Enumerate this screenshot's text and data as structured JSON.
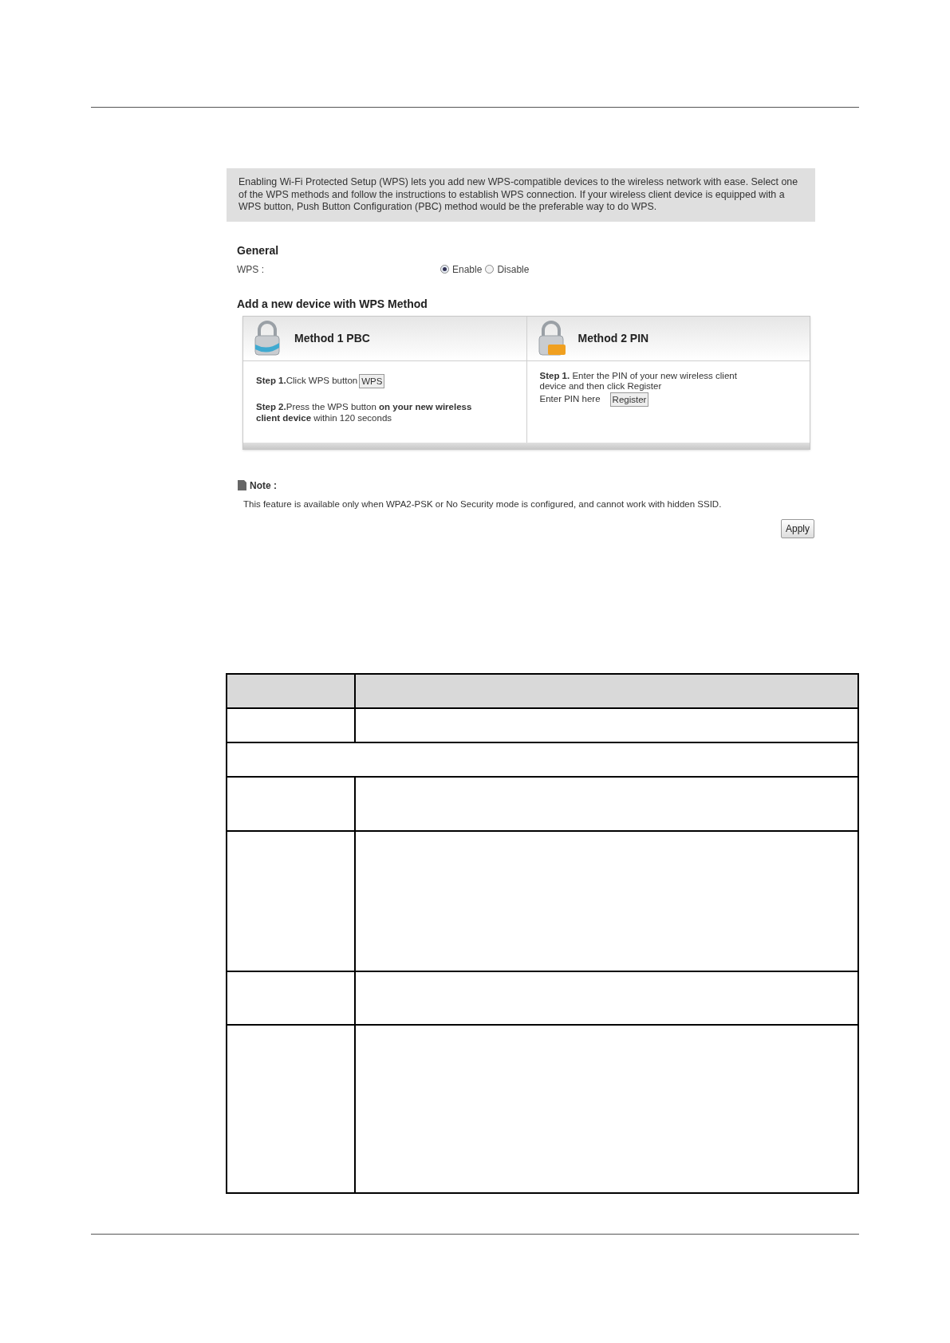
{
  "intro": "Enabling Wi-Fi Protected Setup (WPS) lets you add new WPS-compatible devices to the wireless network with ease. Select one of the WPS methods and follow the instructions to establish WPS connection. If your wireless client device is equipped with a WPS button, Push Button Configuration (PBC) method would be the preferable way to do WPS.",
  "general": {
    "heading": "General",
    "wps_label": "WPS :",
    "options": [
      {
        "label": "Enable",
        "selected": true
      },
      {
        "label": "Disable",
        "selected": false
      }
    ]
  },
  "methods": {
    "heading": "Add a new device with WPS Method",
    "cards": [
      {
        "kind": "pbc",
        "title": "Method 1 PBC",
        "step1": "**Step 1.**Click WPS button",
        "button": "WPS",
        "step2": "**Step 2.**Press the WPS button **on your new wireless client device** within 120 seconds"
      },
      {
        "kind": "pin",
        "title": "Method 2 PIN",
        "step1": "**Step 1.** Enter the PIN of your new wireless client device and then click Register",
        "pin_label": "Enter PIN here",
        "button": "Register"
      }
    ]
  },
  "note": {
    "title": "Note :",
    "text": "This feature is available only when WPA2-PSK or No Security mode is configured, and cannot work with hidden SSID."
  },
  "apply": "Apply"
}
